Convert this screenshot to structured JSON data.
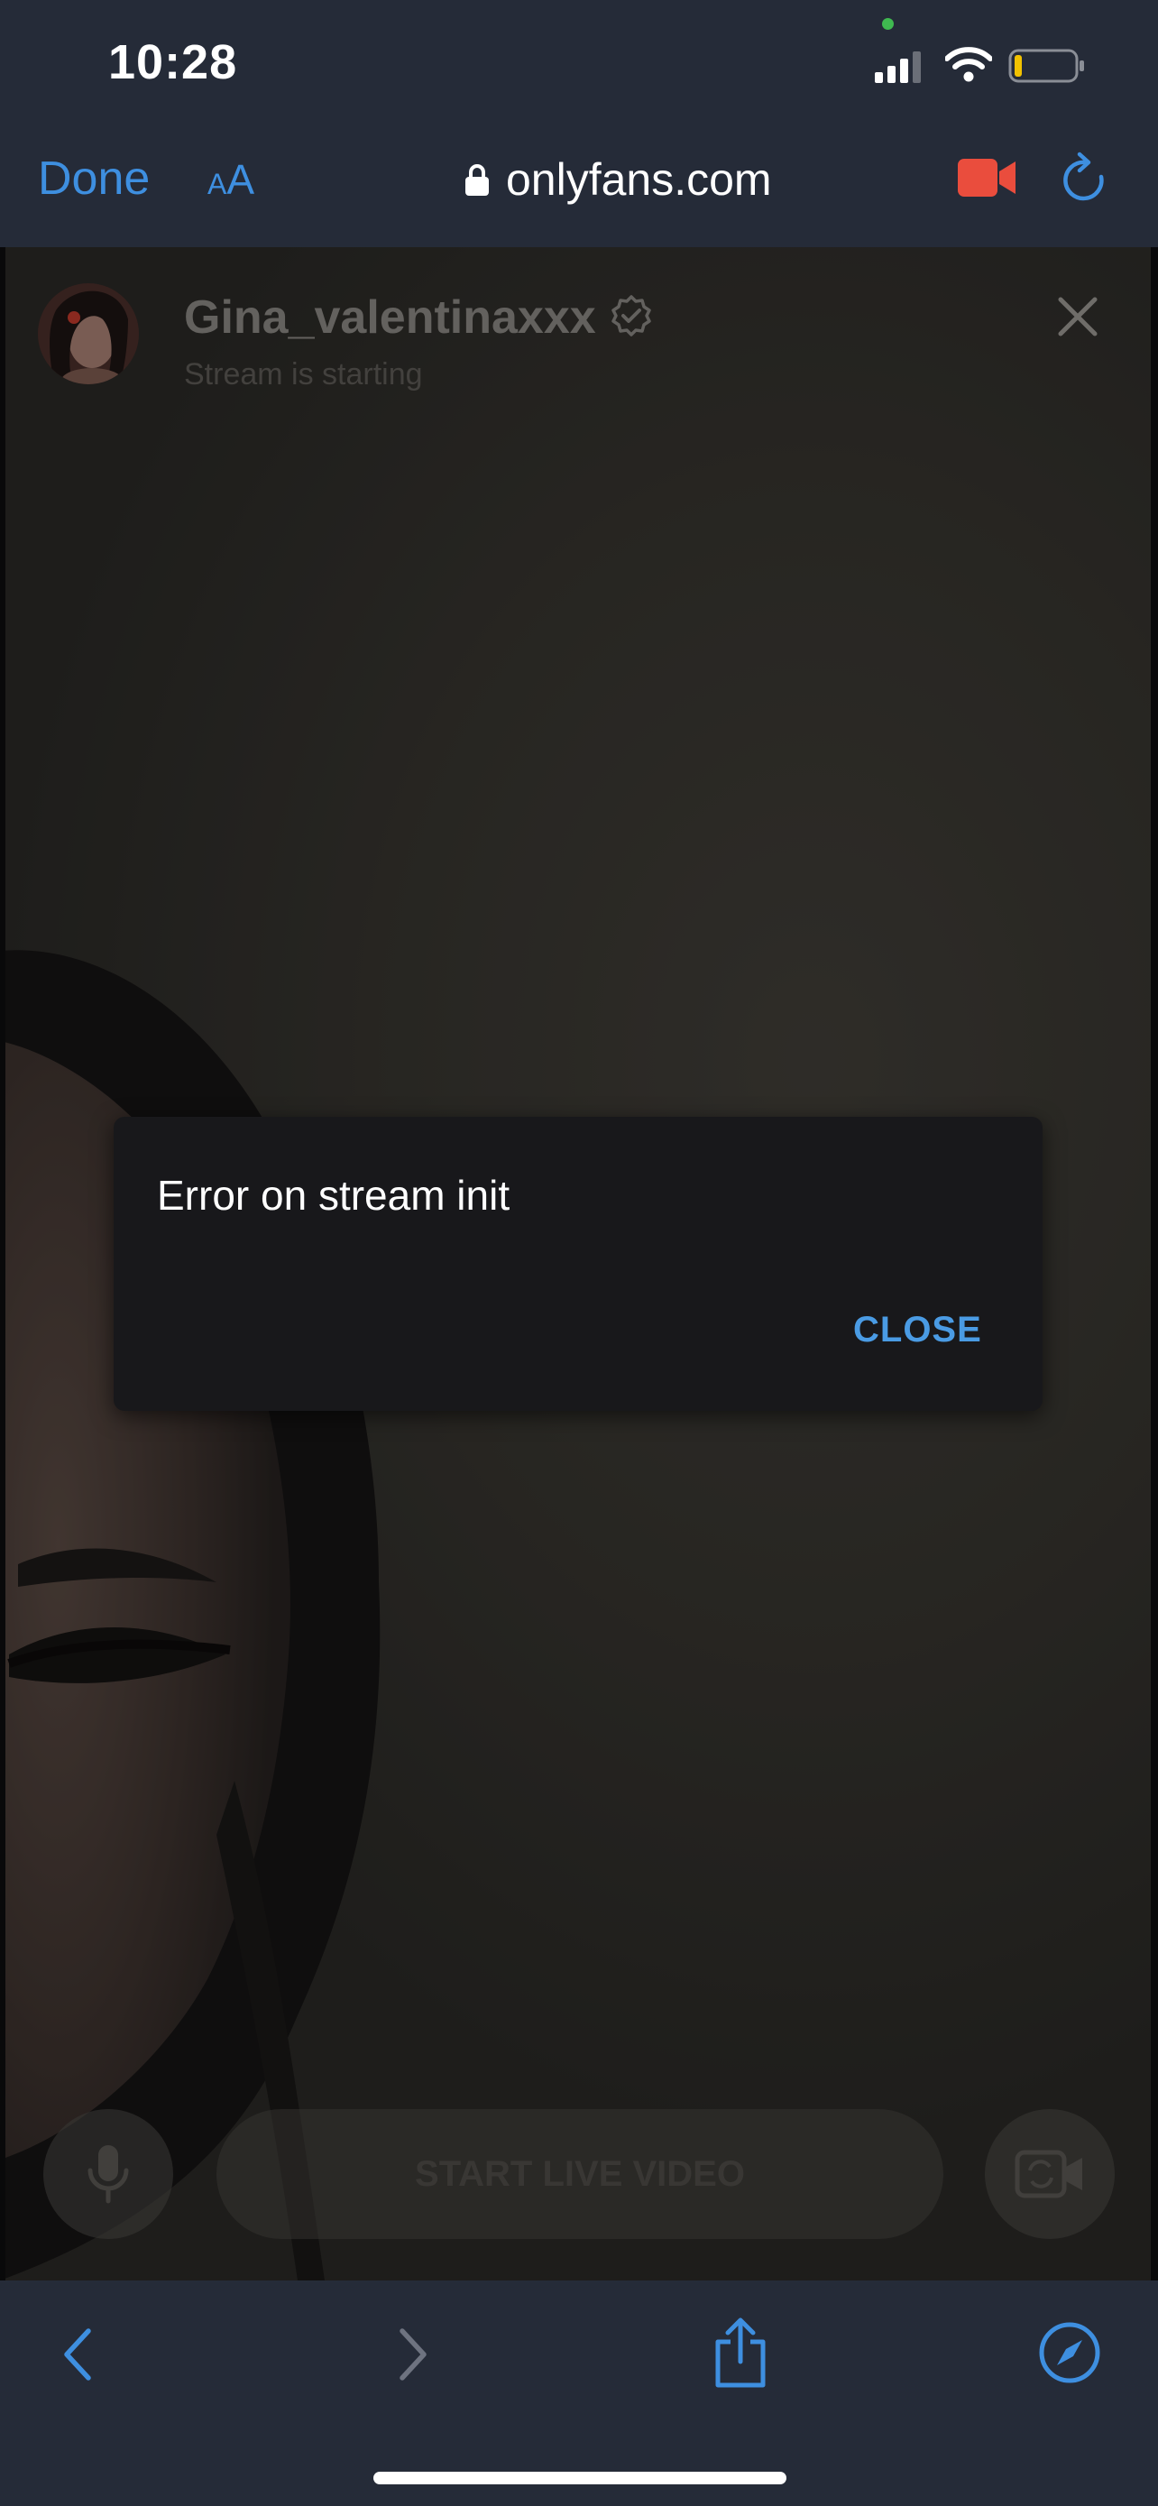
{
  "status_bar": {
    "time": "10:28",
    "icons": [
      "cellular-signal-icon",
      "wifi-icon",
      "battery-icon"
    ],
    "camera_indicator_color": "#3fb950",
    "battery_color": "#f2c200"
  },
  "browser": {
    "done_label": "Done",
    "text_size_small": "A",
    "text_size_big": "A",
    "url": "onlyfans.com",
    "accent_color": "#3e8fe0",
    "camera_color": "#ea4d3d"
  },
  "stream": {
    "username": "Gina_valentinaxxx",
    "status": "Stream is starting",
    "start_button_label": "START LIVE VIDEO"
  },
  "dialog": {
    "message": "Error on stream init",
    "close_label": "CLOSE"
  },
  "toolbar": {
    "icons": [
      "back-icon",
      "forward-icon",
      "share-icon",
      "compass-icon"
    ]
  }
}
